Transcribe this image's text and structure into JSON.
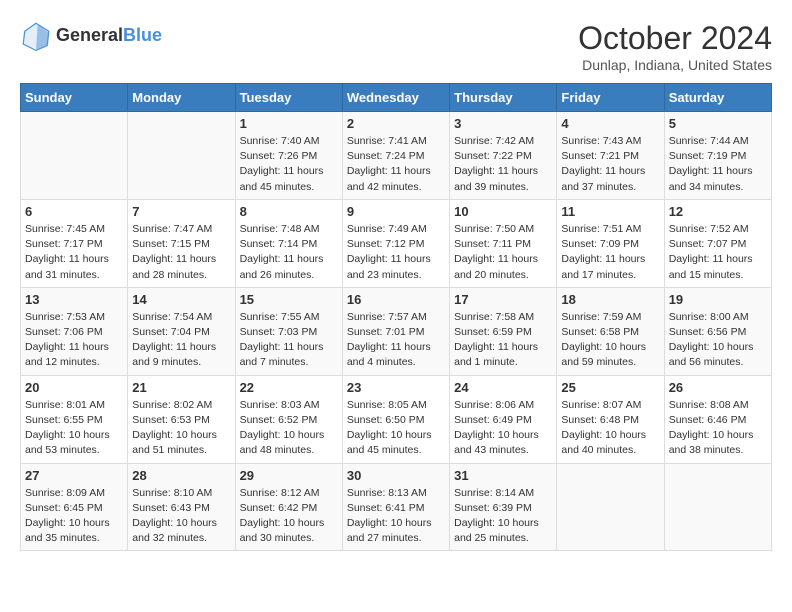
{
  "header": {
    "logo_line1": "General",
    "logo_line2": "Blue",
    "month_title": "October 2024",
    "location": "Dunlap, Indiana, United States"
  },
  "weekdays": [
    "Sunday",
    "Monday",
    "Tuesday",
    "Wednesday",
    "Thursday",
    "Friday",
    "Saturday"
  ],
  "weeks": [
    [
      {
        "day": "",
        "info": ""
      },
      {
        "day": "",
        "info": ""
      },
      {
        "day": "1",
        "info": "Sunrise: 7:40 AM\nSunset: 7:26 PM\nDaylight: 11 hours and 45 minutes."
      },
      {
        "day": "2",
        "info": "Sunrise: 7:41 AM\nSunset: 7:24 PM\nDaylight: 11 hours and 42 minutes."
      },
      {
        "day": "3",
        "info": "Sunrise: 7:42 AM\nSunset: 7:22 PM\nDaylight: 11 hours and 39 minutes."
      },
      {
        "day": "4",
        "info": "Sunrise: 7:43 AM\nSunset: 7:21 PM\nDaylight: 11 hours and 37 minutes."
      },
      {
        "day": "5",
        "info": "Sunrise: 7:44 AM\nSunset: 7:19 PM\nDaylight: 11 hours and 34 minutes."
      }
    ],
    [
      {
        "day": "6",
        "info": "Sunrise: 7:45 AM\nSunset: 7:17 PM\nDaylight: 11 hours and 31 minutes."
      },
      {
        "day": "7",
        "info": "Sunrise: 7:47 AM\nSunset: 7:15 PM\nDaylight: 11 hours and 28 minutes."
      },
      {
        "day": "8",
        "info": "Sunrise: 7:48 AM\nSunset: 7:14 PM\nDaylight: 11 hours and 26 minutes."
      },
      {
        "day": "9",
        "info": "Sunrise: 7:49 AM\nSunset: 7:12 PM\nDaylight: 11 hours and 23 minutes."
      },
      {
        "day": "10",
        "info": "Sunrise: 7:50 AM\nSunset: 7:11 PM\nDaylight: 11 hours and 20 minutes."
      },
      {
        "day": "11",
        "info": "Sunrise: 7:51 AM\nSunset: 7:09 PM\nDaylight: 11 hours and 17 minutes."
      },
      {
        "day": "12",
        "info": "Sunrise: 7:52 AM\nSunset: 7:07 PM\nDaylight: 11 hours and 15 minutes."
      }
    ],
    [
      {
        "day": "13",
        "info": "Sunrise: 7:53 AM\nSunset: 7:06 PM\nDaylight: 11 hours and 12 minutes."
      },
      {
        "day": "14",
        "info": "Sunrise: 7:54 AM\nSunset: 7:04 PM\nDaylight: 11 hours and 9 minutes."
      },
      {
        "day": "15",
        "info": "Sunrise: 7:55 AM\nSunset: 7:03 PM\nDaylight: 11 hours and 7 minutes."
      },
      {
        "day": "16",
        "info": "Sunrise: 7:57 AM\nSunset: 7:01 PM\nDaylight: 11 hours and 4 minutes."
      },
      {
        "day": "17",
        "info": "Sunrise: 7:58 AM\nSunset: 6:59 PM\nDaylight: 11 hours and 1 minute."
      },
      {
        "day": "18",
        "info": "Sunrise: 7:59 AM\nSunset: 6:58 PM\nDaylight: 10 hours and 59 minutes."
      },
      {
        "day": "19",
        "info": "Sunrise: 8:00 AM\nSunset: 6:56 PM\nDaylight: 10 hours and 56 minutes."
      }
    ],
    [
      {
        "day": "20",
        "info": "Sunrise: 8:01 AM\nSunset: 6:55 PM\nDaylight: 10 hours and 53 minutes."
      },
      {
        "day": "21",
        "info": "Sunrise: 8:02 AM\nSunset: 6:53 PM\nDaylight: 10 hours and 51 minutes."
      },
      {
        "day": "22",
        "info": "Sunrise: 8:03 AM\nSunset: 6:52 PM\nDaylight: 10 hours and 48 minutes."
      },
      {
        "day": "23",
        "info": "Sunrise: 8:05 AM\nSunset: 6:50 PM\nDaylight: 10 hours and 45 minutes."
      },
      {
        "day": "24",
        "info": "Sunrise: 8:06 AM\nSunset: 6:49 PM\nDaylight: 10 hours and 43 minutes."
      },
      {
        "day": "25",
        "info": "Sunrise: 8:07 AM\nSunset: 6:48 PM\nDaylight: 10 hours and 40 minutes."
      },
      {
        "day": "26",
        "info": "Sunrise: 8:08 AM\nSunset: 6:46 PM\nDaylight: 10 hours and 38 minutes."
      }
    ],
    [
      {
        "day": "27",
        "info": "Sunrise: 8:09 AM\nSunset: 6:45 PM\nDaylight: 10 hours and 35 minutes."
      },
      {
        "day": "28",
        "info": "Sunrise: 8:10 AM\nSunset: 6:43 PM\nDaylight: 10 hours and 32 minutes."
      },
      {
        "day": "29",
        "info": "Sunrise: 8:12 AM\nSunset: 6:42 PM\nDaylight: 10 hours and 30 minutes."
      },
      {
        "day": "30",
        "info": "Sunrise: 8:13 AM\nSunset: 6:41 PM\nDaylight: 10 hours and 27 minutes."
      },
      {
        "day": "31",
        "info": "Sunrise: 8:14 AM\nSunset: 6:39 PM\nDaylight: 10 hours and 25 minutes."
      },
      {
        "day": "",
        "info": ""
      },
      {
        "day": "",
        "info": ""
      }
    ]
  ]
}
